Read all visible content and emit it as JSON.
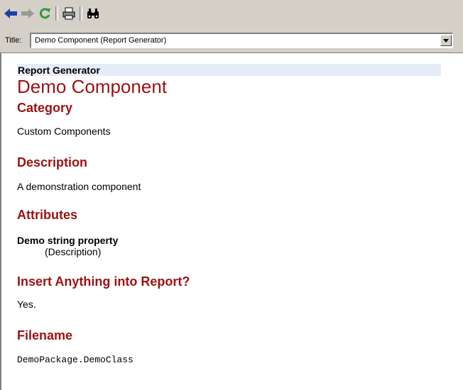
{
  "toolbar": {
    "buttons": [
      {
        "name": "back-button",
        "icon": "arrow-left-icon"
      },
      {
        "name": "forward-button",
        "icon": "arrow-right-icon"
      },
      {
        "name": "refresh-button",
        "icon": "refresh-icon"
      },
      {
        "name": "print-button",
        "icon": "printer-icon"
      },
      {
        "name": "find-button",
        "icon": "binoculars-icon"
      }
    ]
  },
  "title_bar": {
    "label": "Title:",
    "value": "Demo Component (Report Generator)"
  },
  "doc": {
    "header": "Report Generator",
    "title": "Demo Component",
    "sections": {
      "category_heading": "Category",
      "category_text": "Custom Components",
      "description_heading": "Description",
      "description_text": "A demonstration component",
      "attributes_heading": "Attributes",
      "attribute_name": "Demo string property",
      "attribute_desc": "(Description)",
      "insert_heading": "Insert Anything into Report?",
      "insert_text": "Yes.",
      "filename_heading": "Filename",
      "filename_text": "DemoPackage.DemoClass"
    }
  },
  "colors": {
    "heading": "#9b1212",
    "header_bar": "#e6ebf8",
    "chrome": "#d4d0c8",
    "arrow_blue": "#1f3ea8",
    "refresh_green": "#2a9a3a"
  }
}
